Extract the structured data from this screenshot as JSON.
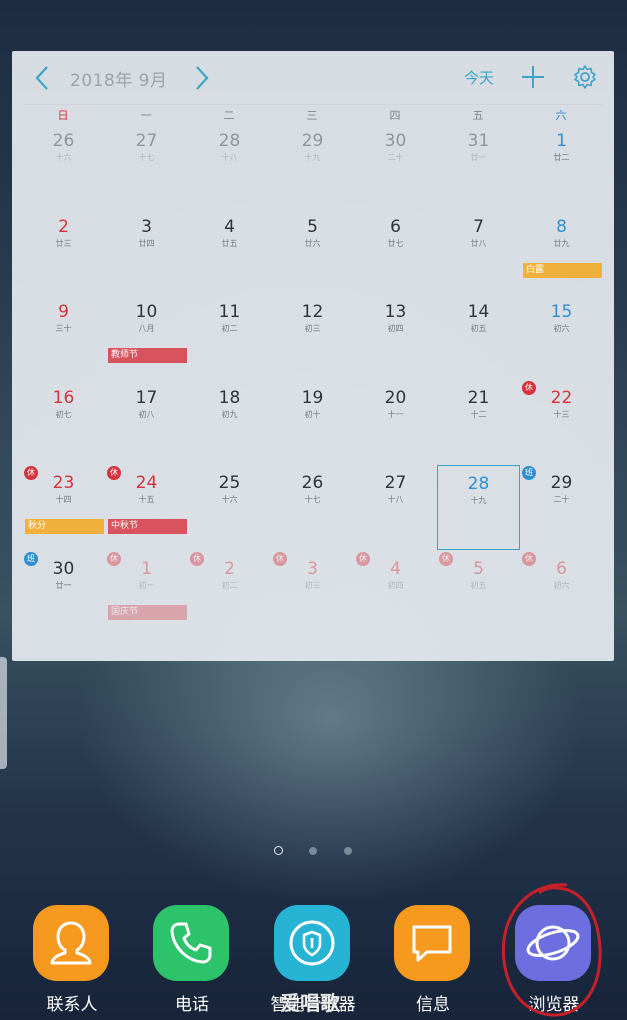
{
  "calendar": {
    "month_title": "2018年 9月",
    "today_label": "今天",
    "weekdays": [
      "日",
      "一",
      "二",
      "三",
      "四",
      "五",
      "六"
    ],
    "weeks": [
      [
        {
          "d": "26",
          "l": "十六",
          "other": true
        },
        {
          "d": "27",
          "l": "十七",
          "other": true
        },
        {
          "d": "28",
          "l": "十八",
          "other": true
        },
        {
          "d": "29",
          "l": "十九",
          "other": true
        },
        {
          "d": "30",
          "l": "二十",
          "other": true
        },
        {
          "d": "31",
          "l": "廿一",
          "other": true
        },
        {
          "d": "1",
          "l": "廿二",
          "blue": true
        }
      ],
      [
        {
          "d": "2",
          "l": "廿三",
          "red": true
        },
        {
          "d": "3",
          "l": "廿四"
        },
        {
          "d": "4",
          "l": "廿五"
        },
        {
          "d": "5",
          "l": "廿六"
        },
        {
          "d": "6",
          "l": "廿七"
        },
        {
          "d": "7",
          "l": "廿八"
        },
        {
          "d": "8",
          "l": "廿九",
          "blue": true,
          "event": "白露",
          "ev": "orange"
        }
      ],
      [
        {
          "d": "9",
          "l": "三十",
          "red": true
        },
        {
          "d": "10",
          "l": "八月",
          "event": "教师节",
          "ev": "red"
        },
        {
          "d": "11",
          "l": "初二"
        },
        {
          "d": "12",
          "l": "初三"
        },
        {
          "d": "13",
          "l": "初四"
        },
        {
          "d": "14",
          "l": "初五"
        },
        {
          "d": "15",
          "l": "初六",
          "blue": true
        }
      ],
      [
        {
          "d": "16",
          "l": "初七",
          "red": true
        },
        {
          "d": "17",
          "l": "初八"
        },
        {
          "d": "18",
          "l": "初九"
        },
        {
          "d": "19",
          "l": "初十"
        },
        {
          "d": "20",
          "l": "十一"
        },
        {
          "d": "21",
          "l": "十二"
        },
        {
          "d": "22",
          "l": "十三",
          "red": true,
          "badge": "休",
          "bt": "rest"
        }
      ],
      [
        {
          "d": "23",
          "l": "十四",
          "red": true,
          "badge": "休",
          "bt": "rest",
          "event": "秋分",
          "ev": "orange"
        },
        {
          "d": "24",
          "l": "十五",
          "red": true,
          "badge": "休",
          "bt": "rest",
          "event": "中秋节",
          "ev": "red"
        },
        {
          "d": "25",
          "l": "十六"
        },
        {
          "d": "26",
          "l": "十七"
        },
        {
          "d": "27",
          "l": "十八"
        },
        {
          "d": "28",
          "l": "十九",
          "selected": true
        },
        {
          "d": "29",
          "l": "二十",
          "badge": "班",
          "bt": "work"
        }
      ],
      [
        {
          "d": "30",
          "l": "廿一",
          "badge": "班",
          "bt": "work"
        },
        {
          "d": "1",
          "l": "初一",
          "other": true,
          "red": true,
          "badge": "休",
          "bt": "rest",
          "event": "国庆节",
          "ev": "red"
        },
        {
          "d": "2",
          "l": "初二",
          "other": true,
          "red": true,
          "badge": "休",
          "bt": "rest"
        },
        {
          "d": "3",
          "l": "初三",
          "other": true,
          "red": true,
          "badge": "休",
          "bt": "rest"
        },
        {
          "d": "4",
          "l": "初四",
          "other": true,
          "red": true,
          "badge": "休",
          "bt": "rest"
        },
        {
          "d": "5",
          "l": "初五",
          "other": true,
          "red": true,
          "badge": "休",
          "bt": "rest"
        },
        {
          "d": "6",
          "l": "初六",
          "other": true,
          "red": true,
          "badge": "休",
          "bt": "rest"
        }
      ]
    ]
  },
  "home": {
    "page_count": 3,
    "active_page": 1
  },
  "dock": [
    {
      "label": "联系人",
      "icon": "contacts-icon",
      "color": "#f59a1f"
    },
    {
      "label": "电话",
      "icon": "phone-icon",
      "color": "#2cc36b"
    },
    {
      "label": "智能管理器",
      "icon": "smart-manager-icon",
      "color": "#27b3d4"
    },
    {
      "label": "信息",
      "icon": "messages-icon",
      "color": "#f59a1f"
    },
    {
      "label": "浏览器",
      "icon": "browser-icon",
      "color": "#6d6fe0"
    }
  ],
  "watermark": "爱唱歌",
  "colors": {
    "accent": "#3aa5c9",
    "holiday_red": "#d8323d",
    "weekend_blue": "#2f8fd0",
    "event_orange": "#f2b13d",
    "event_red": "#d9535e",
    "annotation_circle": "#c8202a"
  }
}
